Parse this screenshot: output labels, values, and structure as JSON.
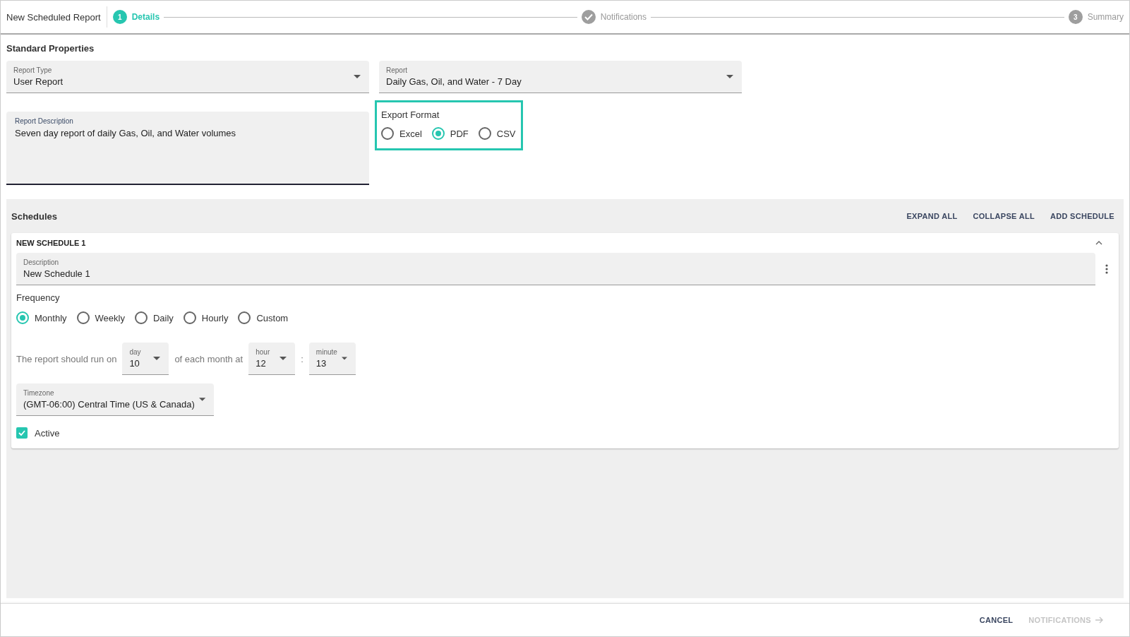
{
  "header": {
    "title": "New Scheduled Report",
    "steps": [
      {
        "number": "1",
        "label": "Details",
        "selected": true,
        "completed": false
      },
      {
        "label": "Notifications",
        "selected": false,
        "completed": true
      },
      {
        "number": "3",
        "label": "Summary",
        "selected": false,
        "completed": false
      }
    ]
  },
  "standard_properties": {
    "heading": "Standard Properties",
    "report_type": {
      "label": "Report Type",
      "value": "User Report"
    },
    "report": {
      "label": "Report",
      "value": "Daily Gas, Oil, and Water - 7 Day"
    },
    "description": {
      "label": "Report Description",
      "value": "Seven day report of daily Gas, Oil, and Water volumes"
    },
    "export_format": {
      "label": "Export Format",
      "options": [
        {
          "label": "Excel",
          "selected": false
        },
        {
          "label": "PDF",
          "selected": true
        },
        {
          "label": "CSV",
          "selected": false
        }
      ]
    }
  },
  "schedules": {
    "heading": "Schedules",
    "actions": [
      "EXPAND ALL",
      "COLLAPSE ALL",
      "ADD SCHEDULE"
    ],
    "items": [
      {
        "title": "NEW SCHEDULE 1",
        "expanded": true,
        "description": {
          "label": "Description",
          "value": "New Schedule 1"
        },
        "frequency": {
          "label": "Frequency",
          "options": [
            {
              "label": "Monthly",
              "selected": true
            },
            {
              "label": "Weekly",
              "selected": false
            },
            {
              "label": "Daily",
              "selected": false
            },
            {
              "label": "Hourly",
              "selected": false
            },
            {
              "label": "Custom",
              "selected": false
            }
          ]
        },
        "run_text_1": "The report should run on",
        "day": {
          "label": "day",
          "value": "10"
        },
        "run_text_2": "of each month at",
        "hour": {
          "label": "hour",
          "value": "12"
        },
        "separator": ":",
        "minute": {
          "label": "minute",
          "value": "13"
        },
        "timezone": {
          "label": "Timezone",
          "value": "(GMT-06:00) Central Time (US & Canada)"
        },
        "active": {
          "label": "Active",
          "checked": true
        }
      }
    ]
  },
  "footer": {
    "cancel": "CANCEL",
    "next": {
      "label": "NOTIFICATIONS",
      "disabled": true
    }
  }
}
